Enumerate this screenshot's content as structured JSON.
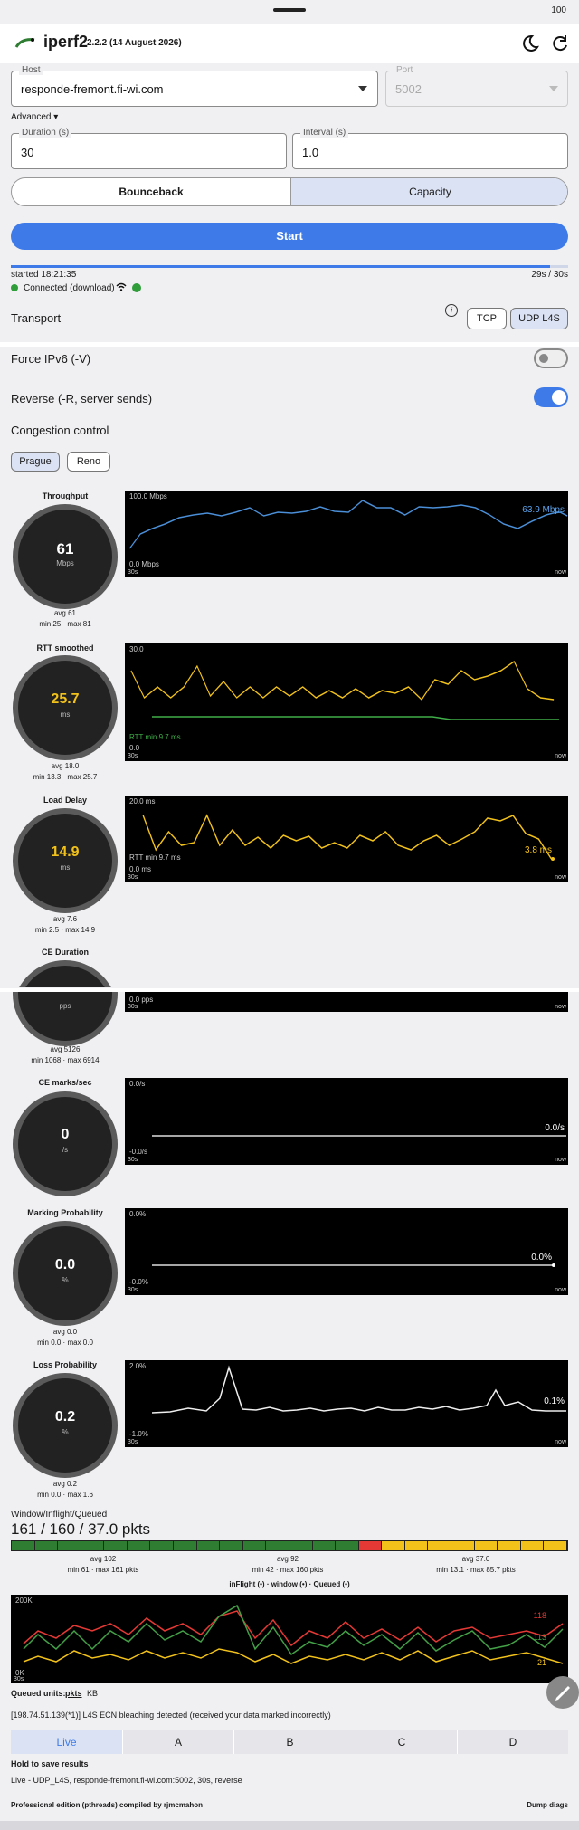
{
  "status": {
    "battery": "100"
  },
  "app": {
    "title": "iperf2",
    "version": "2.2.2 (14 August 2026)"
  },
  "host": {
    "label": "Host",
    "value": "responde-fremont.fi-wi.com"
  },
  "port": {
    "label": "Port",
    "value": "5002"
  },
  "advanced": "Advanced",
  "duration": {
    "label": "Duration (s)",
    "value": "30"
  },
  "interval": {
    "label": "Interval (s)",
    "value": "1.0"
  },
  "mode": {
    "bounceback": "Bounceback",
    "capacity": "Capacity"
  },
  "start": "Start",
  "run": {
    "started": "started 18:21:35",
    "progress": "29s / 30s",
    "progress_fraction": 0.967,
    "connected": "Connected (download)"
  },
  "transport": {
    "label": "Transport",
    "tcp": "TCP",
    "udp": "UDP L4S"
  },
  "force_ipv6": "Force IPv6 (-V)",
  "reverse": "Reverse (-R, server sends)",
  "cc": {
    "label": "Congestion control",
    "prague": "Prague",
    "reno": "Reno"
  },
  "gauges": {
    "throughput": {
      "title": "Throughput",
      "value": "61",
      "unit": "Mbps",
      "avg": "avg 61",
      "range": "min 25 · max 81"
    },
    "rtt": {
      "title": "RTT smoothed",
      "value": "25.7",
      "unit": "ms",
      "avg": "avg 18.0",
      "range": "min 13.3 · max 25.7"
    },
    "load": {
      "title": "Load Delay",
      "value": "14.9",
      "unit": "ms",
      "avg": "avg 7.6",
      "range": "min 2.5 · max 14.9"
    },
    "ce_duration": {
      "title": "CE Duration",
      "unit": "pps",
      "avg": "avg 5126",
      "range": "min 1068 · max 6914"
    },
    "ce_marks": {
      "title": "CE marks/sec",
      "value": "0",
      "unit": "/s"
    },
    "marking": {
      "title": "Marking Probability",
      "value": "0.0",
      "unit": "%",
      "avg": "avg 0.0",
      "range": "min 0.0 · max 0.0"
    },
    "loss": {
      "title": "Loss Probability",
      "value": "0.2",
      "unit": "%",
      "avg": "avg 0.2",
      "range": "min 0.0 · max 1.6"
    }
  },
  "charts": {
    "throughput": {
      "ymax": "100.0 Mbps",
      "ymin": "0.0 Mbps",
      "x0": "30s",
      "x1": "now",
      "last": "63.9 Mbps"
    },
    "rtt": {
      "ymax": "30.0",
      "ymin": "0.0",
      "x0": "30s",
      "x1": "now",
      "note": "RTT min 9.7 ms"
    },
    "load": {
      "ymax": "20.0 ms",
      "ymin": "0.0 ms",
      "x0": "30s",
      "x1": "now",
      "note": "RTT min 9.7 ms",
      "last": "3.8 ms"
    },
    "ce": {
      "ymin": "0.0 pps",
      "x0": "30s",
      "x1": "now"
    },
    "marks": {
      "ymax": "0.0/s",
      "ymin": "-0.0/s",
      "x0": "30s",
      "x1": "now",
      "last": "0.0/s"
    },
    "marking": {
      "ymax": "0.0%",
      "ymin": "-0.0%",
      "x0": "30s",
      "x1": "now",
      "last": "0.0%"
    },
    "loss": {
      "ymax": "2.0%",
      "ymin": "-1.0%",
      "x0": "30s",
      "x1": "now",
      "last": "0.1%"
    }
  },
  "window": {
    "title": "Window/Inflight/Queued",
    "big": "161 / 160 / 37.0 pkts",
    "stats": [
      {
        "avg": "avg 102",
        "range": "min 61 · max 161 pkts"
      },
      {
        "avg": "avg 92",
        "range": "min 42 · max 160 pkts"
      },
      {
        "avg": "avg 37.0",
        "range": "min 13.1 · max 85.7 pkts"
      }
    ],
    "legend": "inFlight (•) · window (•) · Queued (•)",
    "chart": {
      "ymax": "200K",
      "ymin": "0K",
      "x0": "30s",
      "window": "118",
      "inflight": "113",
      "queued": "21"
    }
  },
  "queued_units": {
    "label": "Queued units:",
    "pkts": "pkts",
    "kb": "KB"
  },
  "warning": "[198.74.51.139(*1)] L4S ECN bleaching detected (received your data marked incorrectly)",
  "tabs": [
    "Live",
    "A",
    "B",
    "C",
    "D"
  ],
  "hold": "Hold to save results",
  "summary": "Live - UDP_L4S, responde-fremont.fi-wi.com:5002, 30s, reverse",
  "edition": "Professional edition (pthreads) compiled by rjmcmahon",
  "dump": "Dump diags"
}
